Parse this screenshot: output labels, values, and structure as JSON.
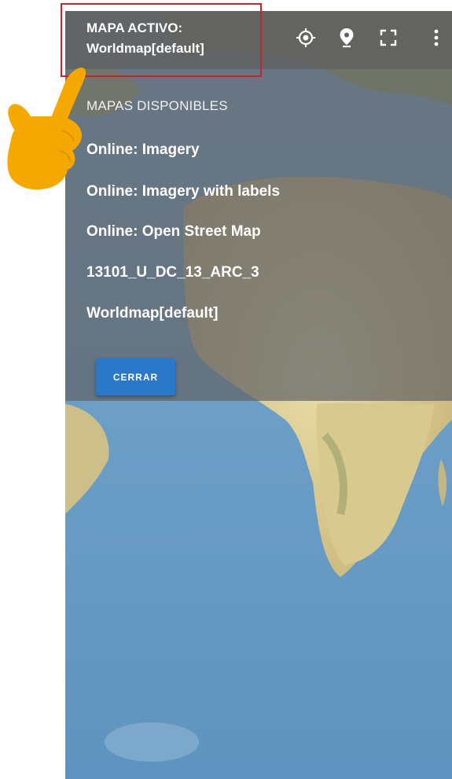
{
  "app": {
    "active_map_label": "MAPA ACTIVO:",
    "active_map_value": "Worldmap[default]"
  },
  "toolbar": {
    "icons": [
      "gps-target-icon",
      "map-marker-icon",
      "fullscreen-icon",
      "more-vert-icon"
    ]
  },
  "dialog": {
    "header": "MAPAS DISPONIBLES",
    "maps": [
      "Online: Imagery",
      "Online: Imagery with labels",
      "Online: Open Street Map",
      "13101_U_DC_13_ARC_3",
      "Worldmap[default]"
    ],
    "close_label": "CERRAR"
  },
  "colors": {
    "appbar": "#606060",
    "button": "#2b78c9",
    "highlight": "#c0272d",
    "hand": "#f5a800",
    "ocean": "#6fa0c6"
  }
}
